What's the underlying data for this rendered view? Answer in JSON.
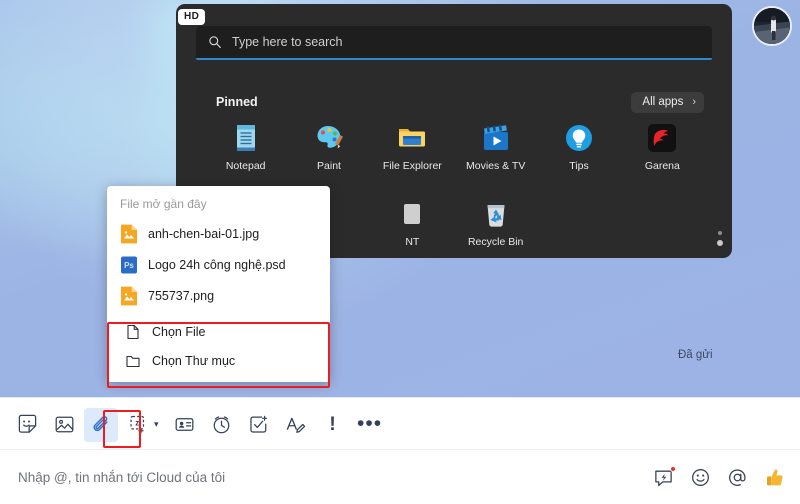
{
  "background": {
    "accent_blue": "#9db3e6",
    "chat_sent_status": "Đã gửi"
  },
  "start_menu_screenshot": {
    "hd_badge": "HD",
    "search": {
      "placeholder": "Type here to search",
      "icon": "search-icon",
      "accent": "#2f89cf"
    },
    "pinned_label": "Pinned",
    "all_apps": {
      "label": "All apps",
      "chevron": "›"
    },
    "apps": [
      {
        "label": "Notepad",
        "icon": "notepad-icon"
      },
      {
        "label": "Paint",
        "icon": "paint-icon"
      },
      {
        "label": "File Explorer",
        "icon": "folder-icon"
      },
      {
        "label": "Movies & TV",
        "icon": "movies-tv-icon"
      },
      {
        "label": "Tips",
        "icon": "lightbulb-icon"
      },
      {
        "label": "Garena",
        "icon": "garena-icon"
      },
      {
        "label": "",
        "icon": ""
      },
      {
        "label": "",
        "icon": ""
      },
      {
        "label": "NT",
        "icon": "paint-3d-icon"
      },
      {
        "label": "Recycle Bin",
        "icon": "recycle-bin-icon"
      },
      {
        "label": "",
        "icon": ""
      },
      {
        "label": "",
        "icon": ""
      }
    ]
  },
  "attachment_popup": {
    "title": "File mở gần đây",
    "recent_files": [
      {
        "name": "anh-chen-bai-01.jpg",
        "icon": "image-file-icon"
      },
      {
        "name": "Logo 24h công nghệ.psd",
        "icon": "photoshop-file-icon"
      },
      {
        "name": "755737.png",
        "icon": "image-file-icon"
      }
    ],
    "actions": [
      {
        "label": "Chọn File",
        "icon": "file-icon"
      },
      {
        "label": "Chọn Thư mục",
        "icon": "folder-outline-icon"
      }
    ],
    "highlight_color": "#ee1c1c"
  },
  "toolbar": {
    "items": [
      {
        "name": "sticker-button",
        "icon": "sticker-icon",
        "active": false
      },
      {
        "name": "image-button",
        "icon": "image-icon",
        "active": false
      },
      {
        "name": "attach-file-button",
        "icon": "paperclip-icon",
        "active": true
      },
      {
        "name": "zalo-capture-button",
        "icon": "zalo-z-icon",
        "active": false
      },
      {
        "name": "business-card-button",
        "icon": "contact-card-icon",
        "active": false
      },
      {
        "name": "reminder-button",
        "icon": "alarm-clock-icon",
        "active": false
      },
      {
        "name": "todo-button",
        "icon": "task-check-icon",
        "active": false
      },
      {
        "name": "text-format-button",
        "icon": "text-format-icon",
        "active": false
      },
      {
        "name": "priority-button",
        "icon": "exclamation-icon",
        "active": false
      },
      {
        "name": "more-options-button",
        "icon": "ellipsis-icon",
        "active": false
      }
    ],
    "caret": "▾",
    "exclamation": "!",
    "ellipsis": "•••"
  },
  "message_input": {
    "placeholder": "Nhập @, tin nhắn tới Cloud của tôi",
    "actions": [
      {
        "name": "quick-message-button",
        "icon": "quick-message-icon",
        "badge": true
      },
      {
        "name": "emoji-button",
        "icon": "emoji-icon",
        "badge": false
      },
      {
        "name": "mention-button",
        "icon": "at-sign-icon",
        "badge": false
      },
      {
        "name": "thumbs-up-button",
        "icon": "thumbs-up-icon",
        "badge": false
      }
    ]
  }
}
